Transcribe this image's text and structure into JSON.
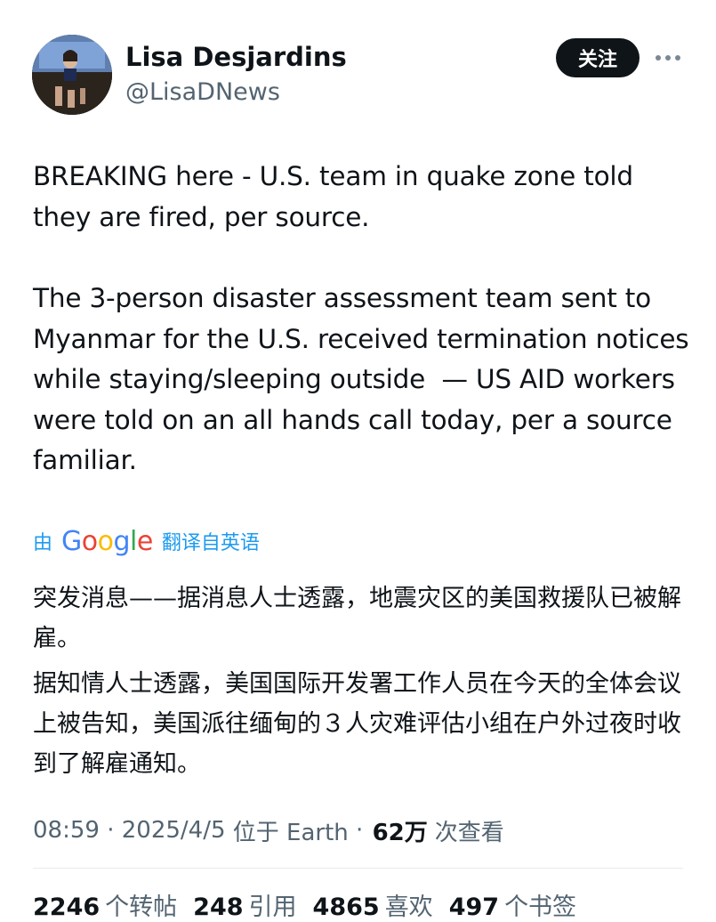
{
  "author": {
    "display_name": "Lisa Desjardins",
    "handle": "@LisaDNews"
  },
  "follow_label": "关注",
  "more_icon": "more-dots-icon",
  "tweet": {
    "paragraphs": [
      "BREAKING here - U.S. team in quake zone told they are fired, per source.",
      "The 3-person disaster assessment team sent to Myanmar for the U.S. received termination notices while staying/sleeping outside  — US AID workers were told on an all hands call today, per a source familiar."
    ]
  },
  "translation": {
    "prefix": "由",
    "google": "Google",
    "suffix": "翻译自英语",
    "paragraphs": [
      "突发消息——据消息人士透露，地震灾区的美国救援队已被解雇。",
      "据知情人士透露，美国国际开发署工作人员在今天的全体会议上被告知，美国派往缅甸的３人灾难评估小组在户外过夜时收到了解雇通知。"
    ]
  },
  "meta": {
    "time": "08:59",
    "date": "2025/4/5",
    "location": "位于 Earth",
    "views_count": "62万",
    "views_label": "次查看"
  },
  "stats": [
    {
      "count": "2246",
      "label": "个转帖"
    },
    {
      "count": "248",
      "label": "引用"
    },
    {
      "count": "4865",
      "label": "喜欢"
    },
    {
      "count": "497",
      "label": "个书签"
    }
  ],
  "colors": {
    "link": "#1d9bf0",
    "text": "#0f1419",
    "muted": "#536471",
    "button": "#0f1419",
    "google_blue": "#4285F4",
    "google_red": "#EA4335",
    "google_yellow": "#FBBC05",
    "google_green": "#34A853"
  }
}
